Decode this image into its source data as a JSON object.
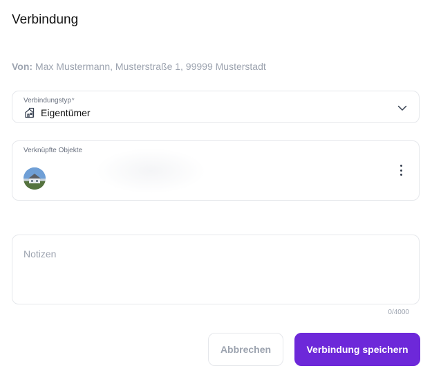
{
  "dialog": {
    "title": "Verbindung"
  },
  "from": {
    "label": "Von:",
    "value": "Max Mustermann, Musterstraße 1, 99999 Musterstadt"
  },
  "connection_type": {
    "label": "Verbindungstyp",
    "required_marker": "*",
    "value": "Eigentümer",
    "icon": "building-icon",
    "dropdown_icon": "chevron-down-icon"
  },
  "linked_objects": {
    "label": "Verknüpfte Objekte",
    "item_icon": "property-photo-avatar",
    "menu_icon": "more-vertical-icon"
  },
  "notes": {
    "placeholder": "Notizen",
    "value": "",
    "counter": "0/4000"
  },
  "actions": {
    "cancel_label": "Abbrechen",
    "save_label": "Verbindung speichern"
  },
  "colors": {
    "primary": "#6d28d9",
    "border": "#e5e7eb",
    "muted_text": "#9ca3af"
  }
}
